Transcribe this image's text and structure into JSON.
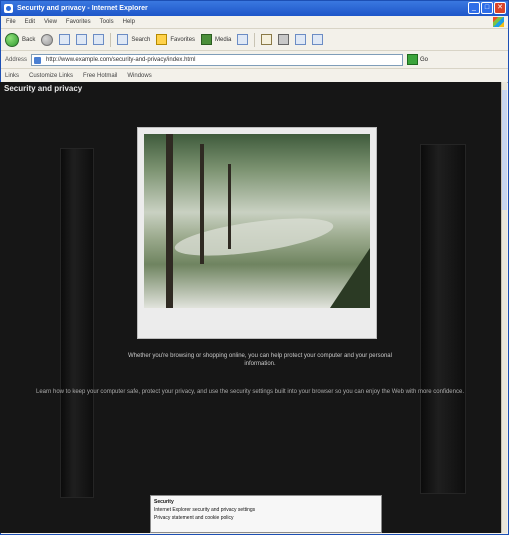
{
  "window": {
    "title": "Security and privacy - Internet Explorer",
    "controls": [
      "_",
      "□",
      "✕"
    ]
  },
  "menubar": {
    "items": [
      "File",
      "Edit",
      "View",
      "Favorites",
      "Tools",
      "Help"
    ]
  },
  "toolbar": {
    "back_label": "Back",
    "search_label": "Search",
    "favorites_label": "Favorites",
    "media_label": "Media"
  },
  "address": {
    "label": "Address",
    "value": "http://www.example.com/security-and-privacy/index.html",
    "go_label": "Go"
  },
  "links": {
    "label": "Links",
    "items": [
      "Customize Links",
      "Free Hotmail",
      "Windows"
    ]
  },
  "page": {
    "header": "Security and privacy",
    "caption": "Whether you're browsing or shopping online, you can help protect your computer and your personal information.",
    "description": "Learn how to keep your computer safe, protect your privacy, and use the security settings built into your browser so you can enjoy the Web with more confidence."
  },
  "popup": {
    "header": "Security",
    "line1": "Internet Explorer security and privacy settings",
    "line2": "Privacy statement and cookie policy"
  }
}
